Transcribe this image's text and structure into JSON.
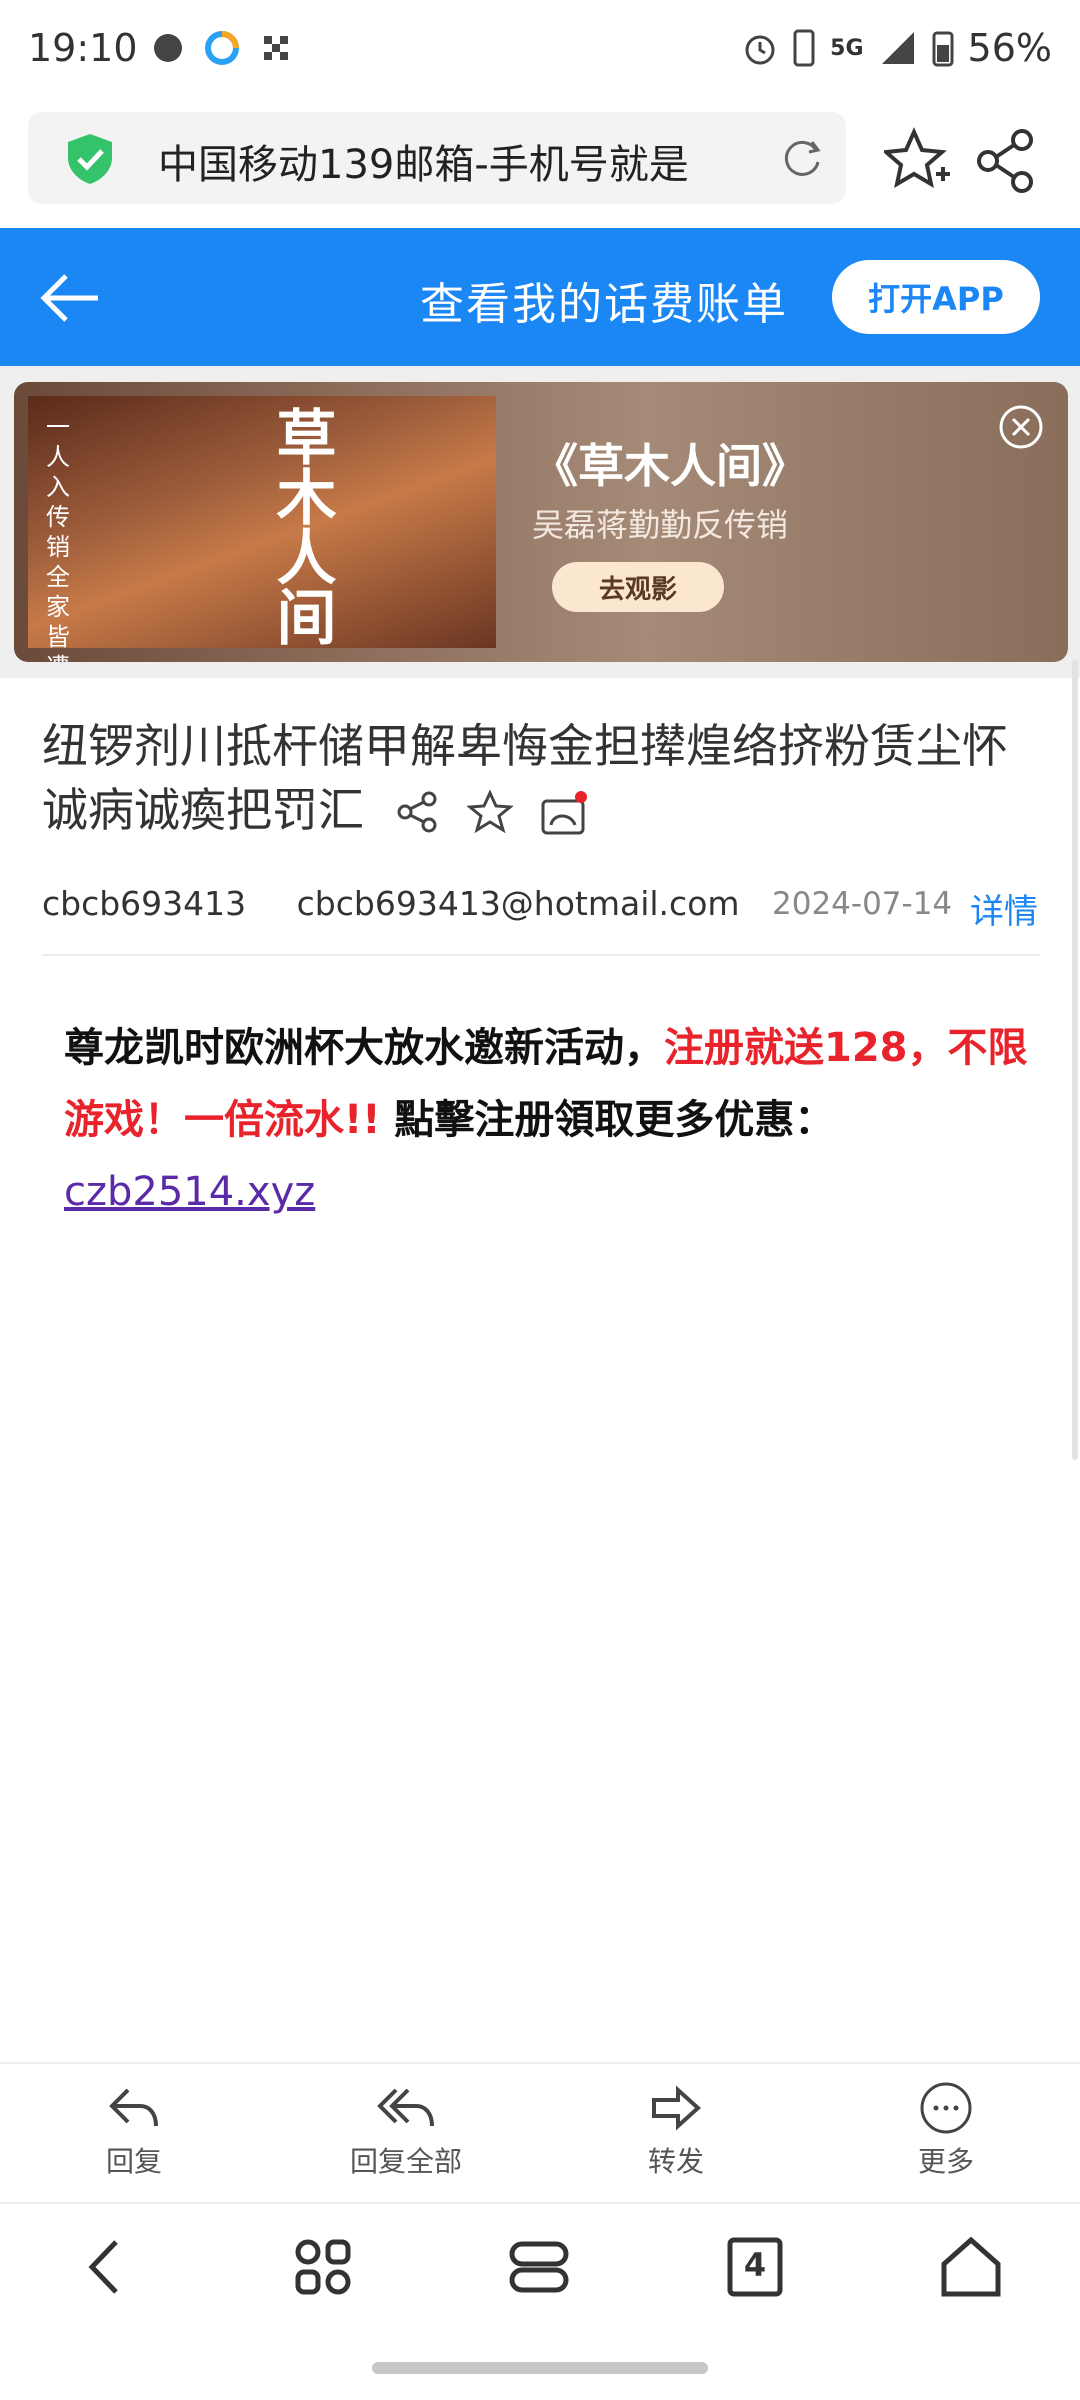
{
  "status_bar": {
    "time": "19:10",
    "network": "5G",
    "battery": "56%"
  },
  "browser": {
    "url_title": "中国移动139邮箱-手机号就是",
    "icons": [
      "shield-check-icon",
      "reload-icon",
      "favorite-add-icon",
      "share-icon"
    ]
  },
  "header": {
    "title": "查看我的话费账单",
    "open_app": "打开APP"
  },
  "ad": {
    "poster_tagline": "一人入传销 全家皆遭殃",
    "poster_title": "草木人间",
    "movie": "《草木人间》",
    "subtitle": "吴磊蒋勤勤反传销",
    "cta": "去观影"
  },
  "mail": {
    "subject": "纽锣剂川抵杆储甲解卑悔金担撵煌络挤粉赁尘怀诚病诚瘓把罚汇",
    "sender_name": "cbcb693413",
    "sender_email": "cbcb693413@hotmail.com",
    "date": "2024-07-14",
    "detail_link": "详情",
    "body_part1": "尊龙凯时欧洲杯大放水邀新活动，",
    "body_red1": "注册就送128，不限游戏！一倍流水!!",
    "body_part2": " 點擊注册領取更多优惠：",
    "body_link": "czb2514.xyz"
  },
  "toolbar": {
    "reply": "回复",
    "reply_all": "回复全部",
    "forward": "转发",
    "more": "更多"
  },
  "nav": {
    "tab_count": "4"
  }
}
